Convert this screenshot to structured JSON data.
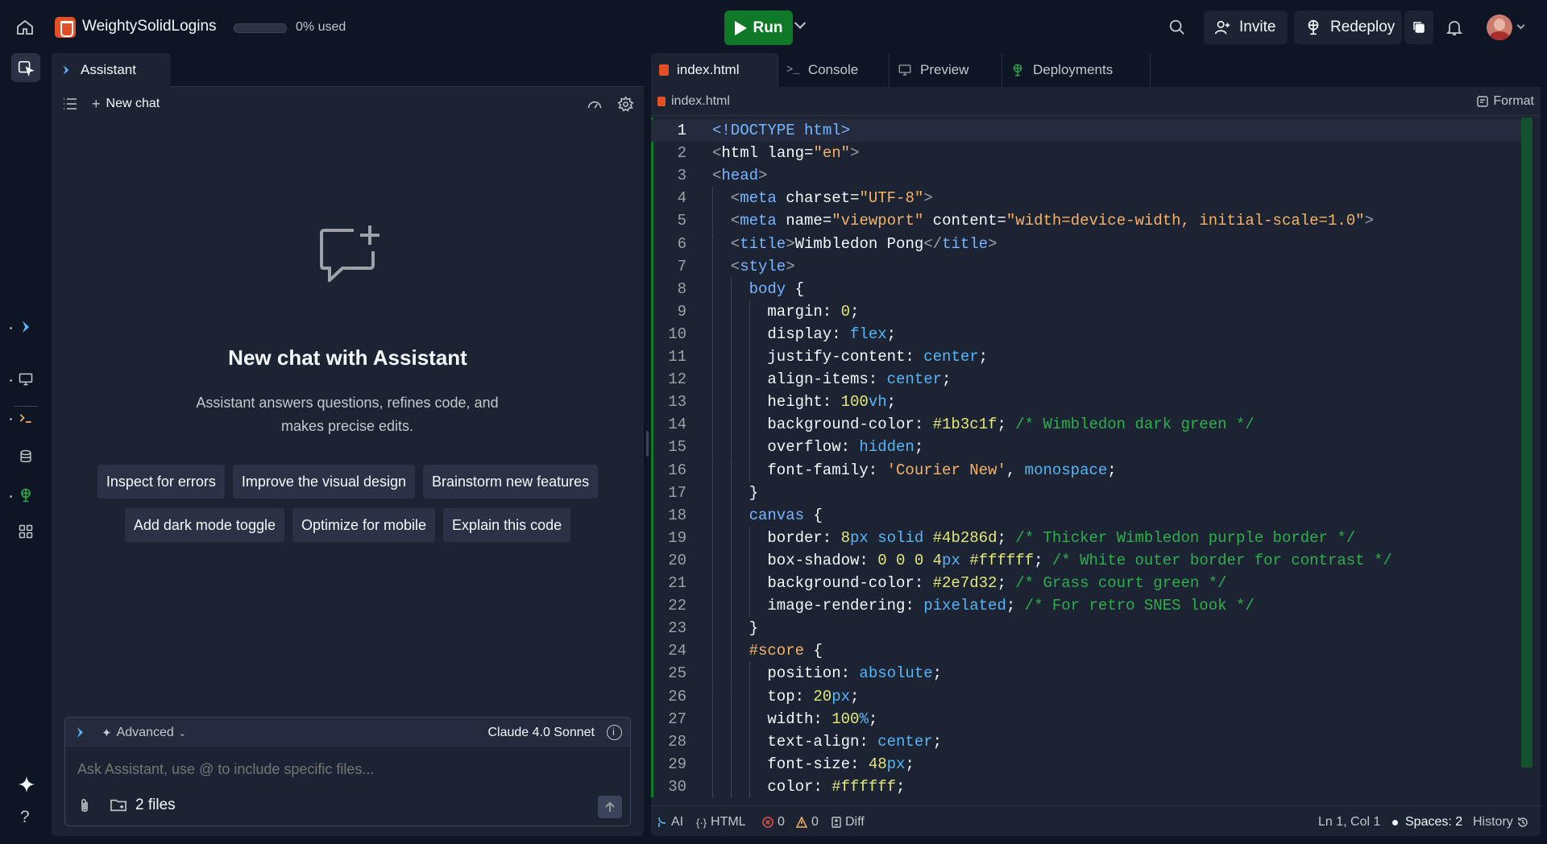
{
  "topbar": {
    "project_name": "WeightySolidLogins",
    "usage_text": "0% used",
    "usage_percent": 0,
    "run_label": "Run",
    "invite_label": "Invite",
    "redeploy_label": "Redeploy"
  },
  "assistant": {
    "tab_label": "Assistant",
    "new_chat_label": "New chat",
    "empty_title": "New chat with Assistant",
    "empty_desc": "Assistant answers questions, refines code, and makes precise edits.",
    "chips_row1": [
      "Inspect for errors",
      "Improve the visual design",
      "Brainstorm new features"
    ],
    "chips_row2": [
      "Add dark mode toggle",
      "Optimize for mobile",
      "Explain this code"
    ],
    "mode_label": "Advanced",
    "model_label": "Claude 4.0 Sonnet",
    "input_placeholder": "Ask Assistant, use @ to include specific files...",
    "files_label": "2 files"
  },
  "editor": {
    "tabs": [
      "index.html",
      "Console",
      "Preview",
      "Deployments"
    ],
    "breadcrumb": "index.html",
    "format_label": "Format",
    "active_line": 1,
    "lines": [
      {
        "n": "1",
        "indent": 0,
        "tokens": [
          [
            "<!DOCTYPE html>",
            "#76b5ff"
          ]
        ]
      },
      {
        "n": "2",
        "indent": 0,
        "tokens": [
          [
            "<",
            "#9da2a6"
          ],
          [
            "html ",
            "#f5f9fc"
          ],
          [
            "lang",
            "#f5f9fc"
          ],
          [
            "=",
            "#f5f9fc"
          ],
          [
            "\"en\"",
            "#f7b267"
          ],
          [
            ">",
            "#9da2a6"
          ]
        ]
      },
      {
        "n": "3",
        "indent": 0,
        "tokens": [
          [
            "<",
            "#9da2a6"
          ],
          [
            "head",
            "#76b5ff"
          ],
          [
            ">",
            "#9da2a6"
          ]
        ]
      },
      {
        "n": "4",
        "indent": 1,
        "tokens": [
          [
            "<",
            "#9da2a6"
          ],
          [
            "meta ",
            "#76b5ff"
          ],
          [
            "charset=",
            "#f5f9fc"
          ],
          [
            "\"UTF-8\"",
            "#f7b267"
          ],
          [
            ">",
            "#9da2a6"
          ]
        ]
      },
      {
        "n": "5",
        "indent": 1,
        "tokens": [
          [
            "<",
            "#9da2a6"
          ],
          [
            "meta ",
            "#76b5ff"
          ],
          [
            "name=",
            "#f5f9fc"
          ],
          [
            "\"viewport\"",
            "#f7b267"
          ],
          [
            " content=",
            "#f5f9fc"
          ],
          [
            "\"width=device-width, initial-scale=1.0\"",
            "#f7b267"
          ],
          [
            ">",
            "#9da2a6"
          ]
        ]
      },
      {
        "n": "6",
        "indent": 1,
        "tokens": [
          [
            "<",
            "#9da2a6"
          ],
          [
            "title",
            "#76b5ff"
          ],
          [
            ">",
            "#9da2a6"
          ],
          [
            "Wimbledon Pong",
            "#f5f9fc"
          ],
          [
            "</",
            "#9da2a6"
          ],
          [
            "title",
            "#76b5ff"
          ],
          [
            ">",
            "#9da2a6"
          ]
        ]
      },
      {
        "n": "7",
        "indent": 1,
        "tokens": [
          [
            "<",
            "#9da2a6"
          ],
          [
            "style",
            "#76b5ff"
          ],
          [
            ">",
            "#9da2a6"
          ]
        ]
      },
      {
        "n": "8",
        "indent": 2,
        "tokens": [
          [
            "body",
            "#76b5ff"
          ],
          [
            " {",
            "#f5f9fc"
          ]
        ]
      },
      {
        "n": "9",
        "indent": 3,
        "tokens": [
          [
            "margin: ",
            "#f5f9fc"
          ],
          [
            "0",
            "#e4e87a"
          ],
          [
            ";",
            "#f5f9fc"
          ]
        ]
      },
      {
        "n": "10",
        "indent": 3,
        "tokens": [
          [
            "display: ",
            "#f5f9fc"
          ],
          [
            "flex",
            "#56b6f7"
          ],
          [
            ";",
            "#f5f9fc"
          ]
        ]
      },
      {
        "n": "11",
        "indent": 3,
        "tokens": [
          [
            "justify-content: ",
            "#f5f9fc"
          ],
          [
            "center",
            "#56b6f7"
          ],
          [
            ";",
            "#f5f9fc"
          ]
        ]
      },
      {
        "n": "12",
        "indent": 3,
        "tokens": [
          [
            "align-items: ",
            "#f5f9fc"
          ],
          [
            "center",
            "#56b6f7"
          ],
          [
            ";",
            "#f5f9fc"
          ]
        ]
      },
      {
        "n": "13",
        "indent": 3,
        "tokens": [
          [
            "height: ",
            "#f5f9fc"
          ],
          [
            "100",
            "#e4e87a"
          ],
          [
            "vh",
            "#56b6f7"
          ],
          [
            ";",
            "#f5f9fc"
          ]
        ]
      },
      {
        "n": "14",
        "indent": 3,
        "tokens": [
          [
            "background-color: ",
            "#f5f9fc"
          ],
          [
            "#1b3c1f",
            "#e4e87a"
          ],
          [
            "; ",
            "#f5f9fc"
          ],
          [
            "/* Wimbledon dark green */",
            "#2fae4e"
          ]
        ]
      },
      {
        "n": "15",
        "indent": 3,
        "tokens": [
          [
            "overflow: ",
            "#f5f9fc"
          ],
          [
            "hidden",
            "#56b6f7"
          ],
          [
            ";",
            "#f5f9fc"
          ]
        ]
      },
      {
        "n": "16",
        "indent": 3,
        "tokens": [
          [
            "font-family: ",
            "#f5f9fc"
          ],
          [
            "'Courier New'",
            "#f7b267"
          ],
          [
            ", ",
            "#f5f9fc"
          ],
          [
            "monospace",
            "#56b6f7"
          ],
          [
            ";",
            "#f5f9fc"
          ]
        ]
      },
      {
        "n": "17",
        "indent": 2,
        "tokens": [
          [
            "}",
            "#f5f9fc"
          ]
        ]
      },
      {
        "n": "18",
        "indent": 2,
        "tokens": [
          [
            "canvas",
            "#76b5ff"
          ],
          [
            " {",
            "#f5f9fc"
          ]
        ]
      },
      {
        "n": "19",
        "indent": 3,
        "tokens": [
          [
            "border: ",
            "#f5f9fc"
          ],
          [
            "8",
            "#e4e87a"
          ],
          [
            "px ",
            "#56b6f7"
          ],
          [
            "solid ",
            "#56b6f7"
          ],
          [
            "#4b286d",
            "#e4e87a"
          ],
          [
            "; ",
            "#f5f9fc"
          ],
          [
            "/* Thicker Wimbledon purple border */",
            "#2fae4e"
          ]
        ]
      },
      {
        "n": "20",
        "indent": 3,
        "tokens": [
          [
            "box-shadow: ",
            "#f5f9fc"
          ],
          [
            "0 0 0 4",
            "#e4e87a"
          ],
          [
            "px ",
            "#56b6f7"
          ],
          [
            "#ffffff",
            "#e4e87a"
          ],
          [
            "; ",
            "#f5f9fc"
          ],
          [
            "/* White outer border for contrast */",
            "#2fae4e"
          ]
        ]
      },
      {
        "n": "21",
        "indent": 3,
        "tokens": [
          [
            "background-color: ",
            "#f5f9fc"
          ],
          [
            "#2e7d32",
            "#e4e87a"
          ],
          [
            "; ",
            "#f5f9fc"
          ],
          [
            "/* Grass court green */",
            "#2fae4e"
          ]
        ]
      },
      {
        "n": "22",
        "indent": 3,
        "tokens": [
          [
            "image-rendering: ",
            "#f5f9fc"
          ],
          [
            "pixelated",
            "#56b6f7"
          ],
          [
            "; ",
            "#f5f9fc"
          ],
          [
            "/* For retro SNES look */",
            "#2fae4e"
          ]
        ]
      },
      {
        "n": "23",
        "indent": 2,
        "tokens": [
          [
            "}",
            "#f5f9fc"
          ]
        ]
      },
      {
        "n": "24",
        "indent": 2,
        "tokens": [
          [
            "#score",
            "#f7b267"
          ],
          [
            " {",
            "#f5f9fc"
          ]
        ]
      },
      {
        "n": "25",
        "indent": 3,
        "tokens": [
          [
            "position: ",
            "#f5f9fc"
          ],
          [
            "absolute",
            "#56b6f7"
          ],
          [
            ";",
            "#f5f9fc"
          ]
        ]
      },
      {
        "n": "26",
        "indent": 3,
        "tokens": [
          [
            "top: ",
            "#f5f9fc"
          ],
          [
            "20",
            "#e4e87a"
          ],
          [
            "px",
            "#56b6f7"
          ],
          [
            ";",
            "#f5f9fc"
          ]
        ]
      },
      {
        "n": "27",
        "indent": 3,
        "tokens": [
          [
            "width: ",
            "#f5f9fc"
          ],
          [
            "100",
            "#e4e87a"
          ],
          [
            "%",
            "#56b6f7"
          ],
          [
            ";",
            "#f5f9fc"
          ]
        ]
      },
      {
        "n": "28",
        "indent": 3,
        "tokens": [
          [
            "text-align: ",
            "#f5f9fc"
          ],
          [
            "center",
            "#56b6f7"
          ],
          [
            ";",
            "#f5f9fc"
          ]
        ]
      },
      {
        "n": "29",
        "indent": 3,
        "tokens": [
          [
            "font-size: ",
            "#f5f9fc"
          ],
          [
            "48",
            "#e4e87a"
          ],
          [
            "px",
            "#56b6f7"
          ],
          [
            ";",
            "#f5f9fc"
          ]
        ]
      },
      {
        "n": "30",
        "indent": 3,
        "tokens": [
          [
            "color: ",
            "#f5f9fc"
          ],
          [
            "#ffffff",
            "#e4e87a"
          ],
          [
            ";",
            "#f5f9fc"
          ]
        ]
      }
    ]
  },
  "statusbar": {
    "ai_label": "AI",
    "lang_label": "HTML",
    "errors": "0",
    "warnings": "0",
    "diff_label": "Diff",
    "cursor": "Ln 1, Col 1",
    "spaces": "Spaces: 2",
    "history_label": "History"
  },
  "colors": {
    "run_green": "#0e7a28",
    "bg": "#0e1525",
    "panel": "#1c2333",
    "html_orange": "#e34f26"
  }
}
